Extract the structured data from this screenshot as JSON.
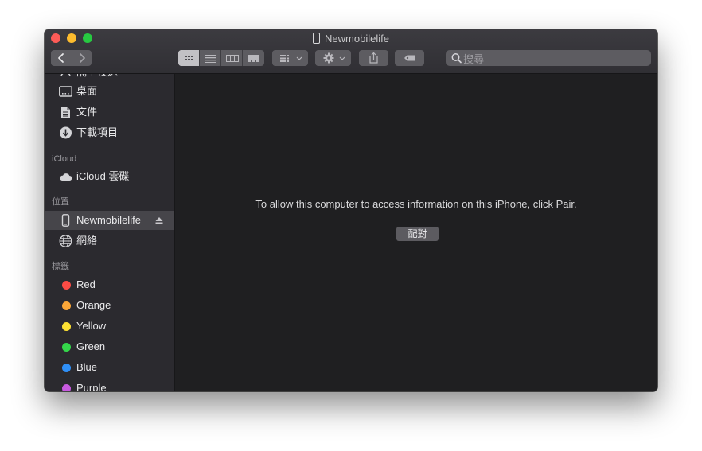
{
  "window": {
    "title": "Newmobilelife"
  },
  "toolbar": {
    "search_placeholder": "搜尋"
  },
  "sidebar": {
    "partial_item": "隔空投送",
    "favorites": [
      {
        "label": "桌面",
        "icon": "desktop-icon"
      },
      {
        "label": "文件",
        "icon": "documents-icon"
      },
      {
        "label": "下載項目",
        "icon": "downloads-icon"
      }
    ],
    "icloud_header": "iCloud",
    "icloud_items": [
      {
        "label": "iCloud 雲碟",
        "icon": "cloud-icon"
      }
    ],
    "locations_header": "位置",
    "locations": [
      {
        "label": "Newmobilelife",
        "icon": "iphone-icon",
        "selected": true
      },
      {
        "label": "網絡",
        "icon": "network-globe-icon"
      }
    ],
    "tags_header": "標籤",
    "tags": [
      {
        "label": "Red",
        "color": "#fc4b45"
      },
      {
        "label": "Orange",
        "color": "#fca738"
      },
      {
        "label": "Yellow",
        "color": "#fde033"
      },
      {
        "label": "Green",
        "color": "#34d74a"
      },
      {
        "label": "Blue",
        "color": "#2f8ff7"
      },
      {
        "label": "Purple",
        "color": "#c85ae0"
      }
    ]
  },
  "main": {
    "message": "To allow this computer to access information on this iPhone, click Pair.",
    "pair_label": "配對"
  }
}
